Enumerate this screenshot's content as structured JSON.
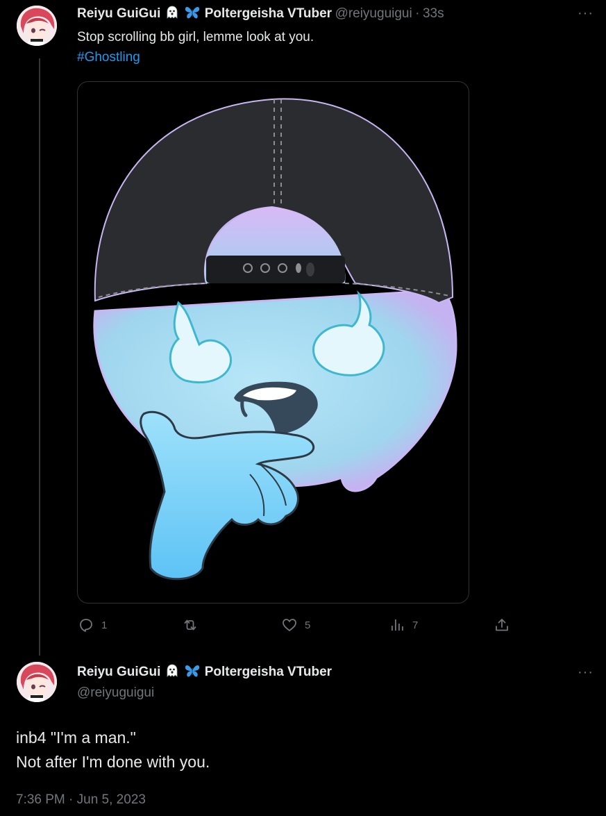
{
  "tweet1": {
    "display_name": "Reiyu GuiGui",
    "display_name_suffix": "Poltergeisha VTuber",
    "handle": "@reiyuguigui",
    "separator": "·",
    "time_ago": "33s",
    "text": "Stop scrolling bb girl, lemme look at you.",
    "hashtag": "#Ghostling",
    "actions": {
      "reply_count": "1",
      "retweet_count": "",
      "like_count": "5",
      "views_count": "7"
    }
  },
  "tweet2": {
    "display_name": "Reiyu GuiGui",
    "display_name_suffix": "Poltergeisha VTuber",
    "handle": "@reiyuguigui",
    "line1": "inb4 \"I'm a man.\"",
    "line2": "Not after I'm done with you.",
    "timestamp": "7:36 PM · Jun 5, 2023"
  },
  "more_icon": "···",
  "colors": {
    "background": "#000000",
    "text": "#e7e9ea",
    "secondary": "#71767b",
    "link": "#1d9bf0",
    "ghost": "#a8dcf2",
    "cap": "#2a2b2f"
  }
}
